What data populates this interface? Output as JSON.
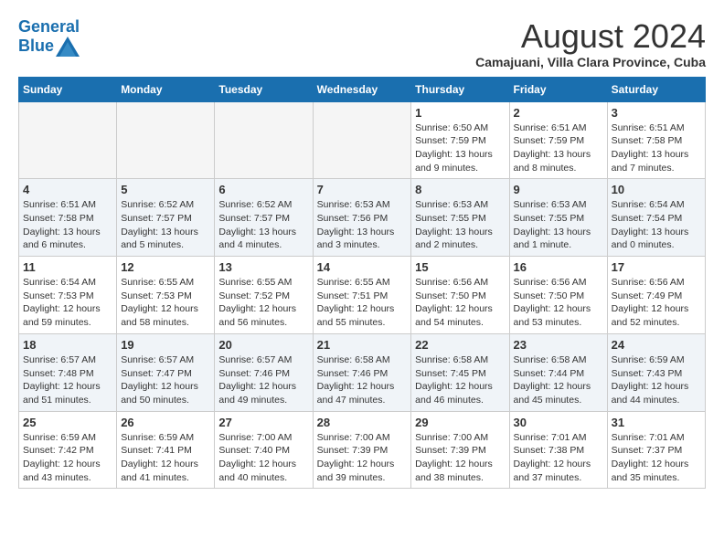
{
  "header": {
    "logo_line1": "General",
    "logo_line2": "Blue",
    "title": "August 2024",
    "location": "Camajuani, Villa Clara Province, Cuba"
  },
  "weekdays": [
    "Sunday",
    "Monday",
    "Tuesday",
    "Wednesday",
    "Thursday",
    "Friday",
    "Saturday"
  ],
  "weeks": [
    [
      {
        "day": "",
        "info": ""
      },
      {
        "day": "",
        "info": ""
      },
      {
        "day": "",
        "info": ""
      },
      {
        "day": "",
        "info": ""
      },
      {
        "day": "1",
        "info": "Sunrise: 6:50 AM\nSunset: 7:59 PM\nDaylight: 13 hours\nand 9 minutes."
      },
      {
        "day": "2",
        "info": "Sunrise: 6:51 AM\nSunset: 7:59 PM\nDaylight: 13 hours\nand 8 minutes."
      },
      {
        "day": "3",
        "info": "Sunrise: 6:51 AM\nSunset: 7:58 PM\nDaylight: 13 hours\nand 7 minutes."
      }
    ],
    [
      {
        "day": "4",
        "info": "Sunrise: 6:51 AM\nSunset: 7:58 PM\nDaylight: 13 hours\nand 6 minutes."
      },
      {
        "day": "5",
        "info": "Sunrise: 6:52 AM\nSunset: 7:57 PM\nDaylight: 13 hours\nand 5 minutes."
      },
      {
        "day": "6",
        "info": "Sunrise: 6:52 AM\nSunset: 7:57 PM\nDaylight: 13 hours\nand 4 minutes."
      },
      {
        "day": "7",
        "info": "Sunrise: 6:53 AM\nSunset: 7:56 PM\nDaylight: 13 hours\nand 3 minutes."
      },
      {
        "day": "8",
        "info": "Sunrise: 6:53 AM\nSunset: 7:55 PM\nDaylight: 13 hours\nand 2 minutes."
      },
      {
        "day": "9",
        "info": "Sunrise: 6:53 AM\nSunset: 7:55 PM\nDaylight: 13 hours\nand 1 minute."
      },
      {
        "day": "10",
        "info": "Sunrise: 6:54 AM\nSunset: 7:54 PM\nDaylight: 13 hours\nand 0 minutes."
      }
    ],
    [
      {
        "day": "11",
        "info": "Sunrise: 6:54 AM\nSunset: 7:53 PM\nDaylight: 12 hours\nand 59 minutes."
      },
      {
        "day": "12",
        "info": "Sunrise: 6:55 AM\nSunset: 7:53 PM\nDaylight: 12 hours\nand 58 minutes."
      },
      {
        "day": "13",
        "info": "Sunrise: 6:55 AM\nSunset: 7:52 PM\nDaylight: 12 hours\nand 56 minutes."
      },
      {
        "day": "14",
        "info": "Sunrise: 6:55 AM\nSunset: 7:51 PM\nDaylight: 12 hours\nand 55 minutes."
      },
      {
        "day": "15",
        "info": "Sunrise: 6:56 AM\nSunset: 7:50 PM\nDaylight: 12 hours\nand 54 minutes."
      },
      {
        "day": "16",
        "info": "Sunrise: 6:56 AM\nSunset: 7:50 PM\nDaylight: 12 hours\nand 53 minutes."
      },
      {
        "day": "17",
        "info": "Sunrise: 6:56 AM\nSunset: 7:49 PM\nDaylight: 12 hours\nand 52 minutes."
      }
    ],
    [
      {
        "day": "18",
        "info": "Sunrise: 6:57 AM\nSunset: 7:48 PM\nDaylight: 12 hours\nand 51 minutes."
      },
      {
        "day": "19",
        "info": "Sunrise: 6:57 AM\nSunset: 7:47 PM\nDaylight: 12 hours\nand 50 minutes."
      },
      {
        "day": "20",
        "info": "Sunrise: 6:57 AM\nSunset: 7:46 PM\nDaylight: 12 hours\nand 49 minutes."
      },
      {
        "day": "21",
        "info": "Sunrise: 6:58 AM\nSunset: 7:46 PM\nDaylight: 12 hours\nand 47 minutes."
      },
      {
        "day": "22",
        "info": "Sunrise: 6:58 AM\nSunset: 7:45 PM\nDaylight: 12 hours\nand 46 minutes."
      },
      {
        "day": "23",
        "info": "Sunrise: 6:58 AM\nSunset: 7:44 PM\nDaylight: 12 hours\nand 45 minutes."
      },
      {
        "day": "24",
        "info": "Sunrise: 6:59 AM\nSunset: 7:43 PM\nDaylight: 12 hours\nand 44 minutes."
      }
    ],
    [
      {
        "day": "25",
        "info": "Sunrise: 6:59 AM\nSunset: 7:42 PM\nDaylight: 12 hours\nand 43 minutes."
      },
      {
        "day": "26",
        "info": "Sunrise: 6:59 AM\nSunset: 7:41 PM\nDaylight: 12 hours\nand 41 minutes."
      },
      {
        "day": "27",
        "info": "Sunrise: 7:00 AM\nSunset: 7:40 PM\nDaylight: 12 hours\nand 40 minutes."
      },
      {
        "day": "28",
        "info": "Sunrise: 7:00 AM\nSunset: 7:39 PM\nDaylight: 12 hours\nand 39 minutes."
      },
      {
        "day": "29",
        "info": "Sunrise: 7:00 AM\nSunset: 7:39 PM\nDaylight: 12 hours\nand 38 minutes."
      },
      {
        "day": "30",
        "info": "Sunrise: 7:01 AM\nSunset: 7:38 PM\nDaylight: 12 hours\nand 37 minutes."
      },
      {
        "day": "31",
        "info": "Sunrise: 7:01 AM\nSunset: 7:37 PM\nDaylight: 12 hours\nand 35 minutes."
      }
    ]
  ]
}
